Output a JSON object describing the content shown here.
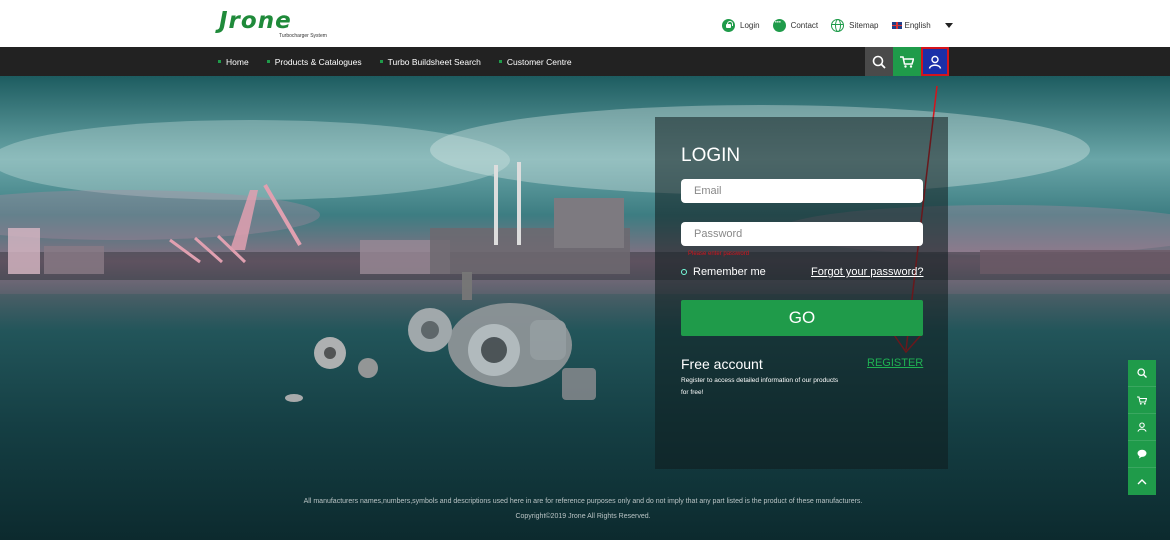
{
  "header": {
    "logo": "Jrone",
    "logo_tagline": "Turbocharger System",
    "links": [
      {
        "label": "Login",
        "icon": "lock-icon"
      },
      {
        "label": "Contact",
        "icon": "chat-icon"
      },
      {
        "label": "Sitemap",
        "icon": "globe-icon"
      }
    ],
    "language": {
      "label": "English",
      "icon": "uk-flag-icon"
    }
  },
  "nav": {
    "items": [
      "Home",
      "Products & Catalogues",
      "Turbo Buildsheet Search",
      "Customer Centre"
    ],
    "buttons": [
      "search-icon",
      "cart-icon",
      "user-icon"
    ]
  },
  "login": {
    "title": "LOGIN",
    "email_placeholder": "Email",
    "password_placeholder": "Password",
    "error": "Please enter password",
    "remember": "Remember me",
    "forgot": "Forgot your password?",
    "go": "GO",
    "free_title": "Free account",
    "free_desc": "Register to access detailed information of our products for free!",
    "register": "REGISTER"
  },
  "sidebar": {
    "buttons": [
      "search-icon",
      "cart-icon",
      "user-icon",
      "chat-icon",
      "up-arrow-icon"
    ]
  },
  "footer": {
    "disclaimer": "All manufacturers names,numbers,symbols and descriptions used here in are for reference purposes only and do not imply that any part listed is the product of these manufacturers.",
    "copyright": "Copyright©2019 Jrone All Rights Reserved."
  },
  "colors": {
    "brand_green": "#1f9b4a",
    "nav_bg": "#222222",
    "user_button": "#1b2fa8",
    "highlight": "#d4141c"
  }
}
